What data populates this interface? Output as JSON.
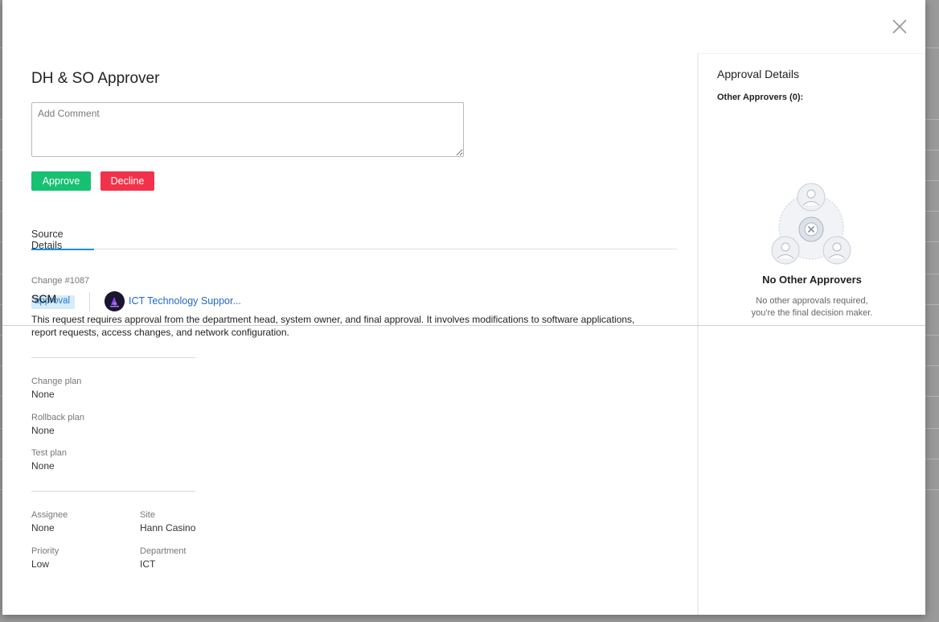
{
  "modal": {
    "title": "DH & SO Approver",
    "comment_placeholder": "Add Comment",
    "approve_label": "Approve",
    "decline_label": "Decline"
  },
  "tabs": [
    {
      "label": "Source Details",
      "active": true
    }
  ],
  "source": {
    "change_number": "Change #1087",
    "short_title": "SCM",
    "tag": "approval",
    "group_name": "ICT Technology Suppor...",
    "description": "This request requires approval from the department head, system owner, and final approval. It involves modifications to software applications, report requests, access changes, and network configuration.",
    "plans": [
      {
        "label": "Change plan",
        "value": "None"
      },
      {
        "label": "Rollback plan",
        "value": "None"
      },
      {
        "label": "Test plan",
        "value": "None"
      }
    ],
    "fields": {
      "assignee": {
        "label": "Assignee",
        "value": "None"
      },
      "site": {
        "label": "Site",
        "value": "Hann Casino"
      },
      "priority": {
        "label": "Priority",
        "value": "Low"
      },
      "department": {
        "label": "Department",
        "value": "ICT"
      }
    }
  },
  "approval_details": {
    "title": "Approval Details",
    "other_approvers": "Other Approvers (0):",
    "empty_title": "No Other Approvers",
    "empty_desc_line1": "No other approvals required,",
    "empty_desc_line2": "you're the final decision maker."
  },
  "colors": {
    "approve": "#16c172",
    "decline": "#f2324a",
    "accent": "#1a8fe0",
    "link": "#2468c4",
    "tag_bg": "#d6ebfb"
  }
}
